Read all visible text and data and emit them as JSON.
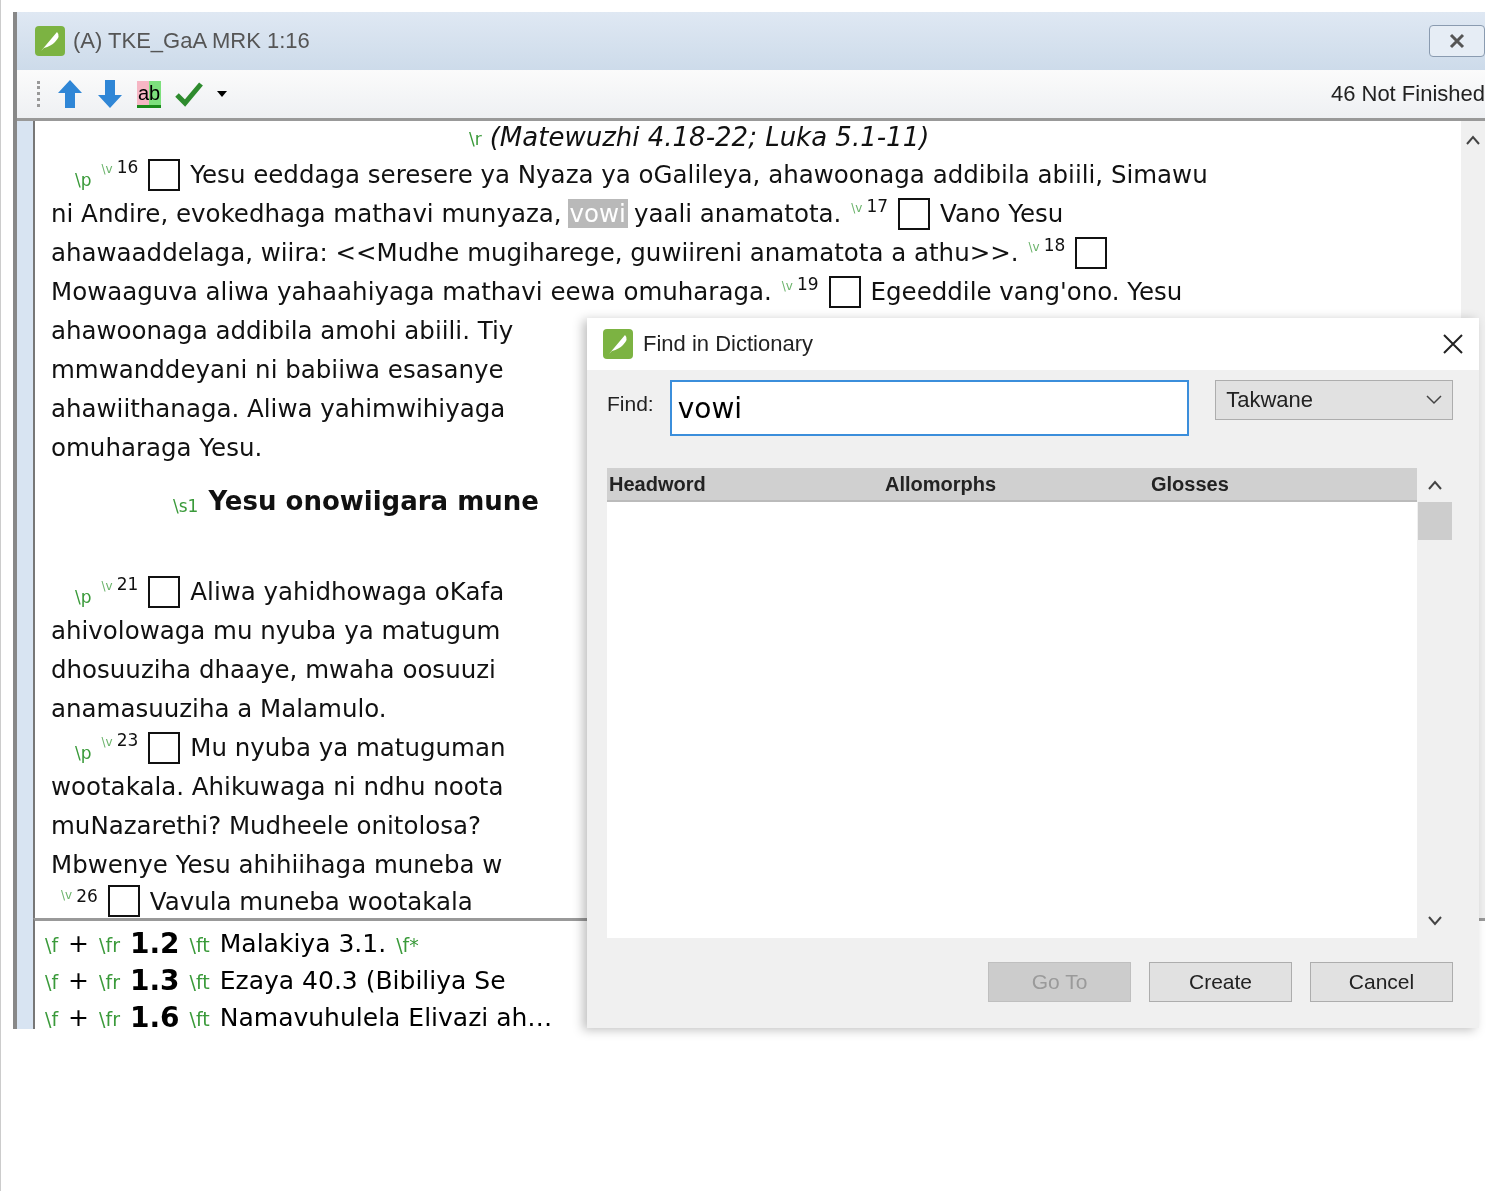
{
  "window": {
    "title": "(A) TKE_GaA MRK 1:16"
  },
  "toolbar": {
    "spell_label": "ab",
    "status": "46 Not Finished"
  },
  "editor": {
    "reference": {
      "marker": "\\r",
      "text": "(Matewuzhi 4.18-22; Luka 5.1-11)"
    },
    "lines": [
      {
        "kind": "para",
        "segments": [
          {
            "kind": "marker",
            "text": "\\p"
          },
          {
            "kind": "verse",
            "marker": "\\v",
            "number": "16"
          },
          {
            "kind": "text",
            "text": "Yesu eeddaga seresere ya Nyaza ya oGalileya, ahawoonaga addibila abiili, Simawu"
          }
        ]
      },
      {
        "kind": "line",
        "segments": [
          {
            "kind": "text",
            "text": "ni Andire, evokedhaga mathavi munyaza,"
          },
          {
            "kind": "highlight",
            "text": "vowi"
          },
          {
            "kind": "text",
            "text": "yaali anamatota."
          },
          {
            "kind": "verse",
            "marker": "\\v",
            "number": "17"
          },
          {
            "kind": "text",
            "text": "Vano Yesu"
          }
        ]
      },
      {
        "kind": "line",
        "segments": [
          {
            "kind": "text",
            "text": "ahawaaddelaga, wiira: <<Mudhe mugiharege, guwiireni anamatota a athu>>."
          },
          {
            "kind": "verse",
            "marker": "\\v",
            "number": "18"
          }
        ]
      },
      {
        "kind": "line",
        "segments": [
          {
            "kind": "text",
            "text": "Mowaaguva aliwa yahaahiyaga mathavi eewa omuharaga."
          },
          {
            "kind": "verse",
            "marker": "\\v",
            "number": "19"
          },
          {
            "kind": "text",
            "text": "Egeeddile vang'ono. Yesu"
          }
        ]
      },
      {
        "kind": "line",
        "segments": [
          {
            "kind": "text",
            "text": "ahawoonaga addibila amohi abiili. Tiy"
          }
        ]
      },
      {
        "kind": "line",
        "segments": [
          {
            "kind": "text",
            "text": "mmwanddeyani ni babiiwa esasanye"
          }
        ]
      },
      {
        "kind": "line",
        "segments": [
          {
            "kind": "text",
            "text": "ahawiithanaga. Aliwa yahimwihiyaga"
          }
        ]
      },
      {
        "kind": "line",
        "segments": [
          {
            "kind": "text",
            "text": "omuharaga Yesu."
          }
        ]
      },
      {
        "kind": "heading",
        "segments": [
          {
            "kind": "marker",
            "text": "\\s1"
          },
          {
            "kind": "heading",
            "text": "Yesu onowiigara mune"
          }
        ]
      },
      {
        "kind": "para",
        "segments": [
          {
            "kind": "marker",
            "text": "\\p"
          },
          {
            "kind": "verse",
            "marker": "\\v",
            "number": "21"
          },
          {
            "kind": "text",
            "text": "Aliwa yahidhowaga oKafa"
          }
        ]
      },
      {
        "kind": "line",
        "segments": [
          {
            "kind": "text",
            "text": "ahivolowaga mu nyuba ya matugum"
          }
        ]
      },
      {
        "kind": "line",
        "segments": [
          {
            "kind": "text",
            "text": "dhosuuziha dhaaye, mwaha oosuuzi"
          }
        ]
      },
      {
        "kind": "line",
        "segments": [
          {
            "kind": "text",
            "text": "anamasuuziha a Malamulo."
          }
        ]
      },
      {
        "kind": "para",
        "segments": [
          {
            "kind": "marker",
            "text": "\\p"
          },
          {
            "kind": "verse",
            "marker": "\\v",
            "number": "23"
          },
          {
            "kind": "text",
            "text": "Mu nyuba ya matuguman"
          }
        ]
      },
      {
        "kind": "line",
        "segments": [
          {
            "kind": "text",
            "text": "wootakala. Ahikuwaga ni ndhu noota"
          }
        ]
      },
      {
        "kind": "line",
        "segments": [
          {
            "kind": "text",
            "text": "muNazarethi? Mudheele onitolosa?"
          }
        ]
      },
      {
        "kind": "line",
        "segments": [
          {
            "kind": "text",
            "text": "Mbwenye Yesu ahihiihaga muneba w"
          }
        ]
      },
      {
        "kind": "cut",
        "segments": [
          {
            "kind": "verse",
            "marker": "\\v",
            "number": "26"
          },
          {
            "kind": "text",
            "text": "Vavula muneba wootakala"
          }
        ]
      }
    ]
  },
  "footnotes": [
    [
      {
        "kind": "marker",
        "text": "\\f"
      },
      {
        "kind": "text",
        "text": "+"
      },
      {
        "kind": "marker",
        "text": "\\fr"
      },
      {
        "kind": "ref",
        "text": "1.2"
      },
      {
        "kind": "marker",
        "text": "\\ft"
      },
      {
        "kind": "text",
        "text": "Malakiya 3.1."
      },
      {
        "kind": "marker",
        "text": "\\f*"
      }
    ],
    [
      {
        "kind": "marker",
        "text": "\\f"
      },
      {
        "kind": "text",
        "text": "+"
      },
      {
        "kind": "marker",
        "text": "\\fr"
      },
      {
        "kind": "ref",
        "text": "1.3"
      },
      {
        "kind": "marker",
        "text": "\\ft"
      },
      {
        "kind": "text",
        "text": "Ezaya 40.3 (Bibiliya Se"
      }
    ],
    [
      {
        "kind": "marker",
        "text": "\\f"
      },
      {
        "kind": "text",
        "text": "+"
      },
      {
        "kind": "marker",
        "text": "\\fr"
      },
      {
        "kind": "ref",
        "text": "1.6"
      },
      {
        "kind": "marker",
        "text": "\\ft"
      },
      {
        "kind": "text",
        "text": "Namavuhulela Elivazi ah…"
      }
    ]
  ],
  "dialog": {
    "title": "Find in Dictionary",
    "find_label": "Find:",
    "find_value": "vowi",
    "language": "Takwane",
    "columns": [
      "Headword",
      "Allomorphs",
      "Glosses"
    ],
    "buttons": [
      {
        "label": "Go To",
        "disabled": true
      },
      {
        "label": "Create",
        "disabled": false
      },
      {
        "label": "Cancel",
        "disabled": false
      }
    ]
  }
}
